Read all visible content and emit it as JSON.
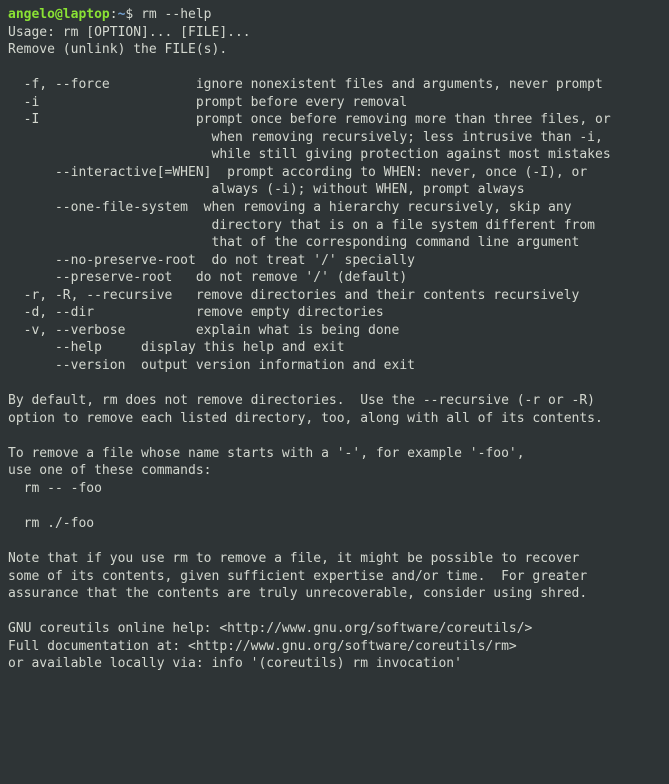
{
  "prompt": {
    "user": "angelo@laptop",
    "colon": ":",
    "path": "~",
    "dollar": "$ ",
    "command": "rm --help"
  },
  "output": {
    "blank": "",
    "l1": "Usage: rm [OPTION]... [FILE]...",
    "l2": "Remove (unlink) the FILE(s).",
    "l3": "  -f, --force           ignore nonexistent files and arguments, never prompt",
    "l4": "  -i                    prompt before every removal",
    "l5": "  -I                    prompt once before removing more than three files, or",
    "l6": "                          when removing recursively; less intrusive than -i,",
    "l7": "                          while still giving protection against most mistakes",
    "l8": "      --interactive[=WHEN]  prompt according to WHEN: never, once (-I), or",
    "l9": "                          always (-i); without WHEN, prompt always",
    "l10": "      --one-file-system  when removing a hierarchy recursively, skip any",
    "l11": "                          directory that is on a file system different from",
    "l12": "                          that of the corresponding command line argument",
    "l13": "      --no-preserve-root  do not treat '/' specially",
    "l14": "      --preserve-root   do not remove '/' (default)",
    "l15": "  -r, -R, --recursive   remove directories and their contents recursively",
    "l16": "  -d, --dir             remove empty directories",
    "l17": "  -v, --verbose         explain what is being done",
    "l18": "      --help     display this help and exit",
    "l19": "      --version  output version information and exit",
    "l20": "By default, rm does not remove directories.  Use the --recursive (-r or -R)",
    "l21": "option to remove each listed directory, too, along with all of its contents.",
    "l22": "To remove a file whose name starts with a '-', for example '-foo',",
    "l23": "use one of these commands:",
    "l24": "  rm -- -foo",
    "l25": "  rm ./-foo",
    "l26": "Note that if you use rm to remove a file, it might be possible to recover",
    "l27": "some of its contents, given sufficient expertise and/or time.  For greater",
    "l28": "assurance that the contents are truly unrecoverable, consider using shred.",
    "l29": "GNU coreutils online help: <http://www.gnu.org/software/coreutils/>",
    "l30": "Full documentation at: <http://www.gnu.org/software/coreutils/rm>",
    "l31": "or available locally via: info '(coreutils) rm invocation'"
  }
}
